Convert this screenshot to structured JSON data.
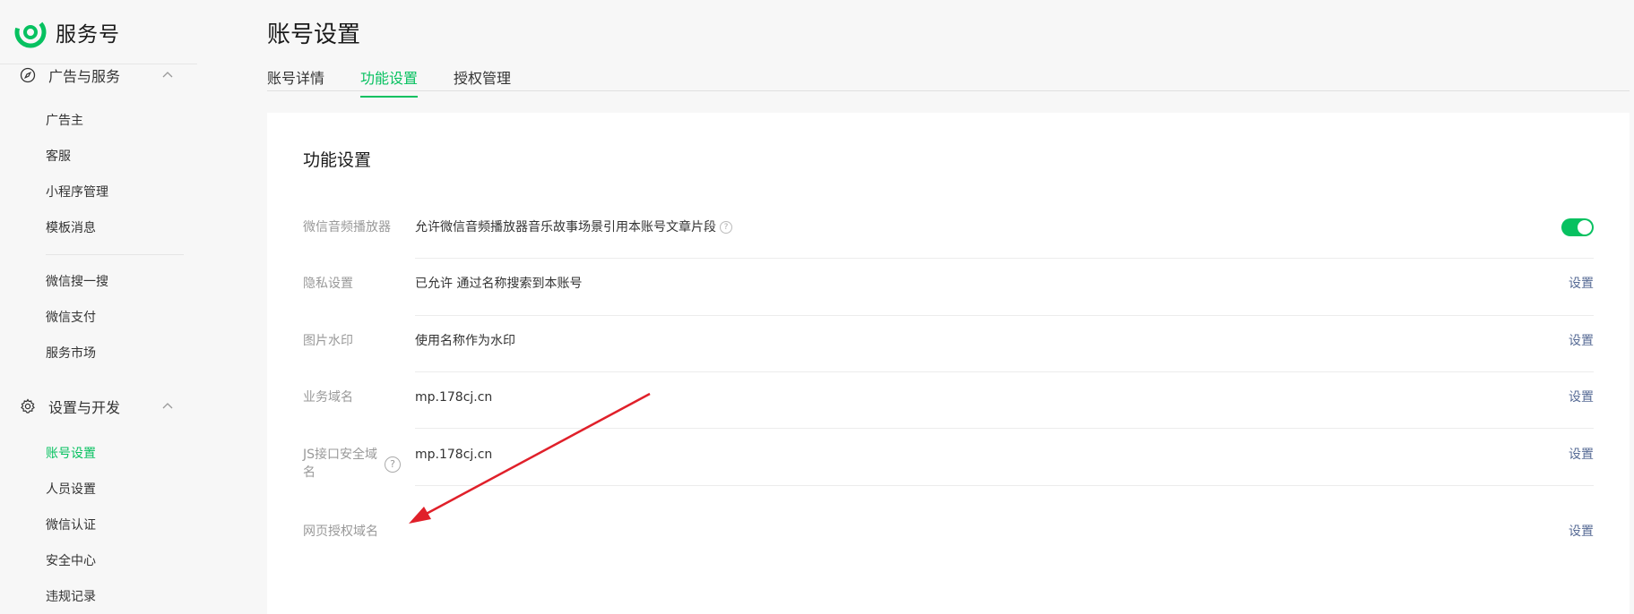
{
  "brand": {
    "name": "服务号"
  },
  "sidebar": {
    "sections": [
      {
        "label": "广告与服务",
        "icon": "compass-icon",
        "items": [
          {
            "label": "广告主"
          },
          {
            "label": "客服"
          },
          {
            "label": "小程序管理"
          },
          {
            "label": "模板消息"
          },
          {
            "label": "微信搜一搜"
          },
          {
            "label": "微信支付"
          },
          {
            "label": "服务市场"
          }
        ]
      },
      {
        "label": "设置与开发",
        "icon": "gear-icon",
        "items": [
          {
            "label": "账号设置",
            "active": true
          },
          {
            "label": "人员设置"
          },
          {
            "label": "微信认证"
          },
          {
            "label": "安全中心"
          },
          {
            "label": "违规记录"
          }
        ]
      }
    ]
  },
  "header": {
    "title": "账号设置",
    "tabs": [
      {
        "label": "账号详情"
      },
      {
        "label": "功能设置",
        "active": true
      },
      {
        "label": "授权管理"
      }
    ]
  },
  "card": {
    "title": "功能设置",
    "rows": [
      {
        "label": "微信音频播放器",
        "value": "允许微信音频播放器音乐故事场景引用本账号文章片段",
        "help": "?",
        "toggle_on": true
      },
      {
        "label": "隐私设置",
        "value": "已允许 通过名称搜索到本账号",
        "action": "设置"
      },
      {
        "label": "图片水印",
        "value": "使用名称作为水印",
        "action": "设置"
      },
      {
        "label": "业务域名",
        "value": "mp.178cj.cn",
        "action": "设置"
      },
      {
        "label": "JS接口安全域名",
        "label_line1": "JS接口安全域",
        "label_line2": "名",
        "help": "?",
        "value": "mp.178cj.cn",
        "action": "设置"
      },
      {
        "label": "网页授权域名",
        "value": "",
        "action": "设置"
      }
    ]
  },
  "colors": {
    "accent": "#07c160",
    "link": "#576b95",
    "annotation_arrow": "#e0202a"
  }
}
